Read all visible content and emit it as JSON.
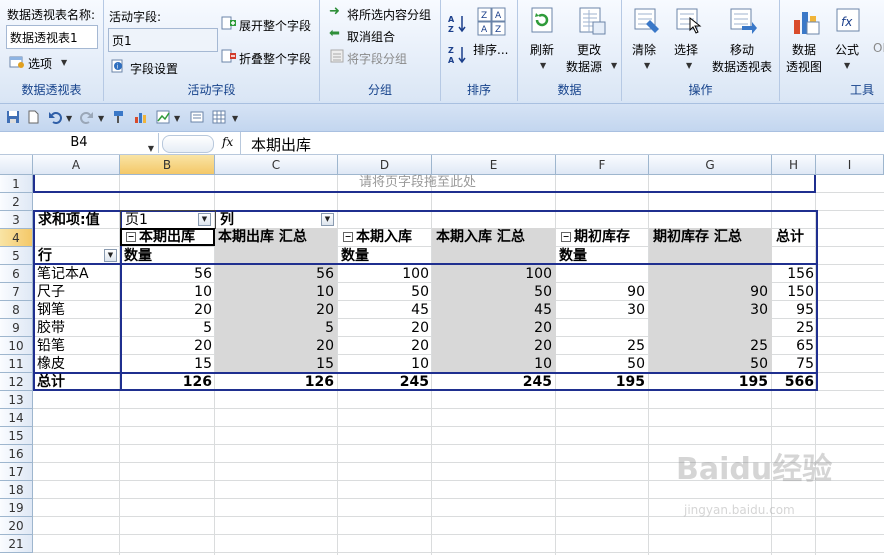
{
  "ribbon": {
    "pivot_group": {
      "name_label": "数据透视表名称:",
      "name_value": "数据透视表1",
      "options": "选项",
      "title": "数据透视表"
    },
    "active_field_group": {
      "label": "活动字段:",
      "value": "页1",
      "field_settings": "字段设置",
      "expand": "展开整个字段",
      "collapse": "折叠整个字段",
      "title": "活动字段"
    },
    "group_group": {
      "group_selection": "将所选内容分组",
      "ungroup": "取消组合",
      "group_field": "将字段分组",
      "title": "分组"
    },
    "sort_group": {
      "sort": "排序...",
      "title": "排序"
    },
    "data_group": {
      "refresh": "刷新",
      "change_source_1": "更改",
      "change_source_2": "数据源",
      "title": "数据"
    },
    "actions_group": {
      "clear": "清除",
      "select": "选择",
      "move_1": "移动",
      "move_2": "数据透视表",
      "title": "操作"
    },
    "tools_group": {
      "chart_1": "数据",
      "chart_2": "透视图",
      "formula": "公式",
      "olap": "OL",
      "title": "工具"
    }
  },
  "formula_bar": {
    "name_box": "B4",
    "fx": "fx",
    "value": "本期出库"
  },
  "grid": {
    "columns": [
      "A",
      "B",
      "C",
      "D",
      "E",
      "F",
      "G",
      "H",
      "I"
    ],
    "rows": [
      "1",
      "2",
      "3",
      "4",
      "5",
      "6",
      "7",
      "8",
      "9",
      "10",
      "11",
      "12",
      "13",
      "14",
      "15",
      "16",
      "17",
      "18",
      "19",
      "20",
      "21"
    ],
    "drop_zone": "请将页字段拖至此处",
    "sum_label": "求和项:值",
    "page_field": "页1",
    "col_field": "列",
    "headers": [
      "本期出库",
      "本期出库 汇总",
      "本期入库",
      "本期入库 汇总",
      "期初库存",
      "期初库存 汇总",
      "总计"
    ],
    "subheaders": [
      "数量",
      "数量",
      "数量"
    ],
    "row_field": "行",
    "data": [
      {
        "item": "笔记本A",
        "v": [
          "56",
          "56",
          "100",
          "100",
          "",
          "",
          "156"
        ]
      },
      {
        "item": "尺子",
        "v": [
          "10",
          "10",
          "50",
          "50",
          "90",
          "90",
          "150"
        ]
      },
      {
        "item": "钢笔",
        "v": [
          "20",
          "20",
          "45",
          "45",
          "30",
          "30",
          "95"
        ]
      },
      {
        "item": "胶带",
        "v": [
          "5",
          "5",
          "20",
          "20",
          "",
          "",
          "25"
        ]
      },
      {
        "item": "铅笔",
        "v": [
          "20",
          "20",
          "20",
          "20",
          "25",
          "25",
          "65"
        ]
      },
      {
        "item": "橡皮",
        "v": [
          "15",
          "15",
          "10",
          "10",
          "50",
          "50",
          "75"
        ]
      }
    ],
    "total": {
      "item": "总计",
      "v": [
        "126",
        "126",
        "245",
        "245",
        "195",
        "195",
        "566"
      ]
    }
  },
  "watermark": {
    "brand": "Baidu经验",
    "url": "jingyan.baidu.com"
  }
}
